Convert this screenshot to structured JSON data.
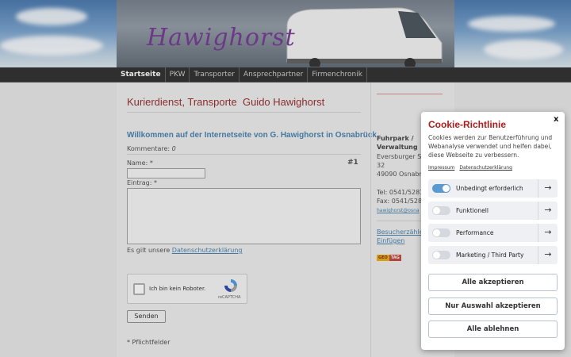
{
  "header": {
    "logo_text": "Hawighorst"
  },
  "nav": {
    "items": [
      {
        "label": "Startseite",
        "active": true
      },
      {
        "label": "PKW",
        "active": false
      },
      {
        "label": "Transporter",
        "active": false
      },
      {
        "label": "Ansprechpartner",
        "active": false
      },
      {
        "label": "Firmenchronik",
        "active": false
      }
    ]
  },
  "main": {
    "title": "Kurierdienst, Transporte  Guido Hawighorst",
    "welcome": "Willkommen auf der Internetseite von G. Hawighorst in Osnabrück",
    "comments_label": "Kommentare:",
    "comments_count": "0",
    "entry_number": "#1",
    "name_label": "Name: *",
    "entry_label": "Eintrag: *",
    "privacy_prefix": "Es gilt unsere ",
    "privacy_link": "Datenschutzerklärung",
    "recaptcha_label": "Ich bin kein Roboter.",
    "recaptcha_brand": "reCAPTCHA",
    "send_button": "Senden",
    "required_note": "* Pflichtfelder"
  },
  "sidebar": {
    "heading_1": "Fuhrpark /",
    "heading_2": "Verwaltung",
    "street": "Eversburger St",
    "number": "32",
    "city": "49090 Osnabrü",
    "tel": "Tel: 0541/5281",
    "fax": "Fax: 0541/5281",
    "email": "hawighorst@osna",
    "counter_link": "Besucherzähler",
    "insert_link": "Einfügen",
    "geotag_left": "GEO",
    "geotag_right": "TAG"
  },
  "cookie": {
    "title": "Cookie-Richtlinie",
    "close": "x",
    "description": "Cookies werden zur Benutzerführung und Webanalyse verwendet und helfen dabei, diese Webseite zu verbessern.",
    "link_impressum": "Impressum",
    "link_privacy": "Datenschutzerklärung",
    "categories": [
      {
        "label": "Unbedingt erforderlich",
        "enabled": true
      },
      {
        "label": "Funktionell",
        "enabled": false
      },
      {
        "label": "Performance",
        "enabled": false
      },
      {
        "label": "Marketing / Third Party",
        "enabled": false
      }
    ],
    "arrow": "→",
    "btn_accept_all": "Alle akzeptieren",
    "btn_accept_selection": "Nur Auswahl akzeptieren",
    "btn_reject_all": "Alle ablehnen"
  },
  "colors": {
    "accent_red": "#b01b1b",
    "link_blue": "#3a78a8",
    "toggle_on": "#5a9ad0"
  }
}
